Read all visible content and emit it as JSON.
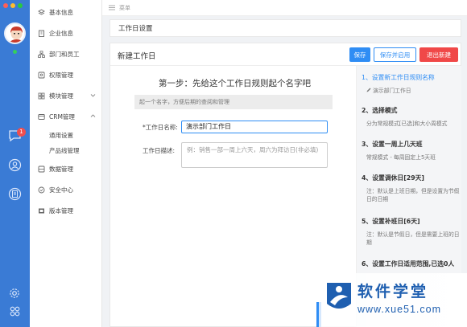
{
  "app": {
    "topbar_label": "菜单"
  },
  "colors": {
    "rail_bg": "#3a7bd5",
    "accent": "#2f8df4",
    "danger": "#f04848",
    "badge": "#f04e4e",
    "online": "#36d05a"
  },
  "rail": {
    "badge_count": "1",
    "icons": [
      "avatar",
      "chat-icon",
      "contacts-icon",
      "document-icon",
      "settings-icon",
      "apps-icon"
    ]
  },
  "sidebar": {
    "items": [
      {
        "label": "基本信息",
        "icon": "layers-icon"
      },
      {
        "label": "企业信息",
        "icon": "building-icon"
      },
      {
        "label": "部门和员工",
        "icon": "org-icon"
      },
      {
        "label": "权限管理",
        "icon": "key-icon"
      },
      {
        "label": "模块管理",
        "icon": "grid-icon"
      },
      {
        "label": "CRM管理",
        "icon": "crm-icon"
      },
      {
        "label": "数据管理",
        "icon": "database-icon"
      },
      {
        "label": "安全中心",
        "icon": "shield-icon"
      },
      {
        "label": "版本管理",
        "icon": "version-icon"
      }
    ],
    "crm_sub": [
      "通用设置",
      "产品线管理"
    ]
  },
  "page": {
    "title": "工作日设置"
  },
  "panel": {
    "title": "新建工作日",
    "buttons": {
      "save": "保存",
      "save_enable": "保存并启用",
      "exit": "退出新建"
    },
    "step_title": "第一步：先给这个工作日规则起个名字吧",
    "step_hint": "起一个名字，方便后期的查阅和管理",
    "name_label": "*工作日名称:",
    "name_value": "演示部门工作日",
    "desc_label": "工作日描述:",
    "desc_placeholder": "例：销售一部一周上六天，周六为拜访日(非必填)"
  },
  "steps": [
    {
      "title": "1、设置新工作日规则名称",
      "desc": "演示部门工作日",
      "active": true
    },
    {
      "title": "2、选择模式",
      "desc": "分为常规模式[已选]和大小周模式"
    },
    {
      "title": "3、设置一周上几天班",
      "desc": "常规模式 - 每周固定上5天班"
    },
    {
      "title": "4、设置调休日[29天]",
      "desc": "注：默认是上班日期，但是设置为节假日的日期"
    },
    {
      "title": "5、设置补班日[6天]",
      "desc": "注：默认是节假日，但是需要上班的日期"
    },
    {
      "title": "6、设置工作日适用范围,已选0人",
      "desc": ""
    }
  ],
  "watermark": {
    "cn": "软件学堂",
    "url": "www.xue51.com"
  }
}
